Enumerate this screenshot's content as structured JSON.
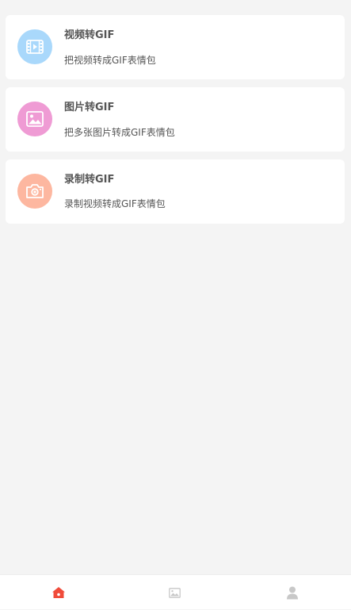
{
  "features": [
    {
      "title": "视频转GIF",
      "subtitle": "把视频转成GIF表情包",
      "icon": "film-icon",
      "color": "#a9d8fb"
    },
    {
      "title": "图片转GIF",
      "subtitle": "把多张图片转成GIF表情包",
      "icon": "image-icon",
      "color": "#ef9bd4"
    },
    {
      "title": "录制转GIF",
      "subtitle": "录制视频转成GIF表情包",
      "icon": "camera-icon",
      "color": "#fdb7a0"
    }
  ],
  "tabbar": {
    "tabs": [
      {
        "icon": "home-icon",
        "active": true,
        "color": "#f04b3a"
      },
      {
        "icon": "image-icon",
        "active": false,
        "color": "#c8c8c8"
      },
      {
        "icon": "user-icon",
        "active": false,
        "color": "#c8c8c8"
      }
    ]
  }
}
